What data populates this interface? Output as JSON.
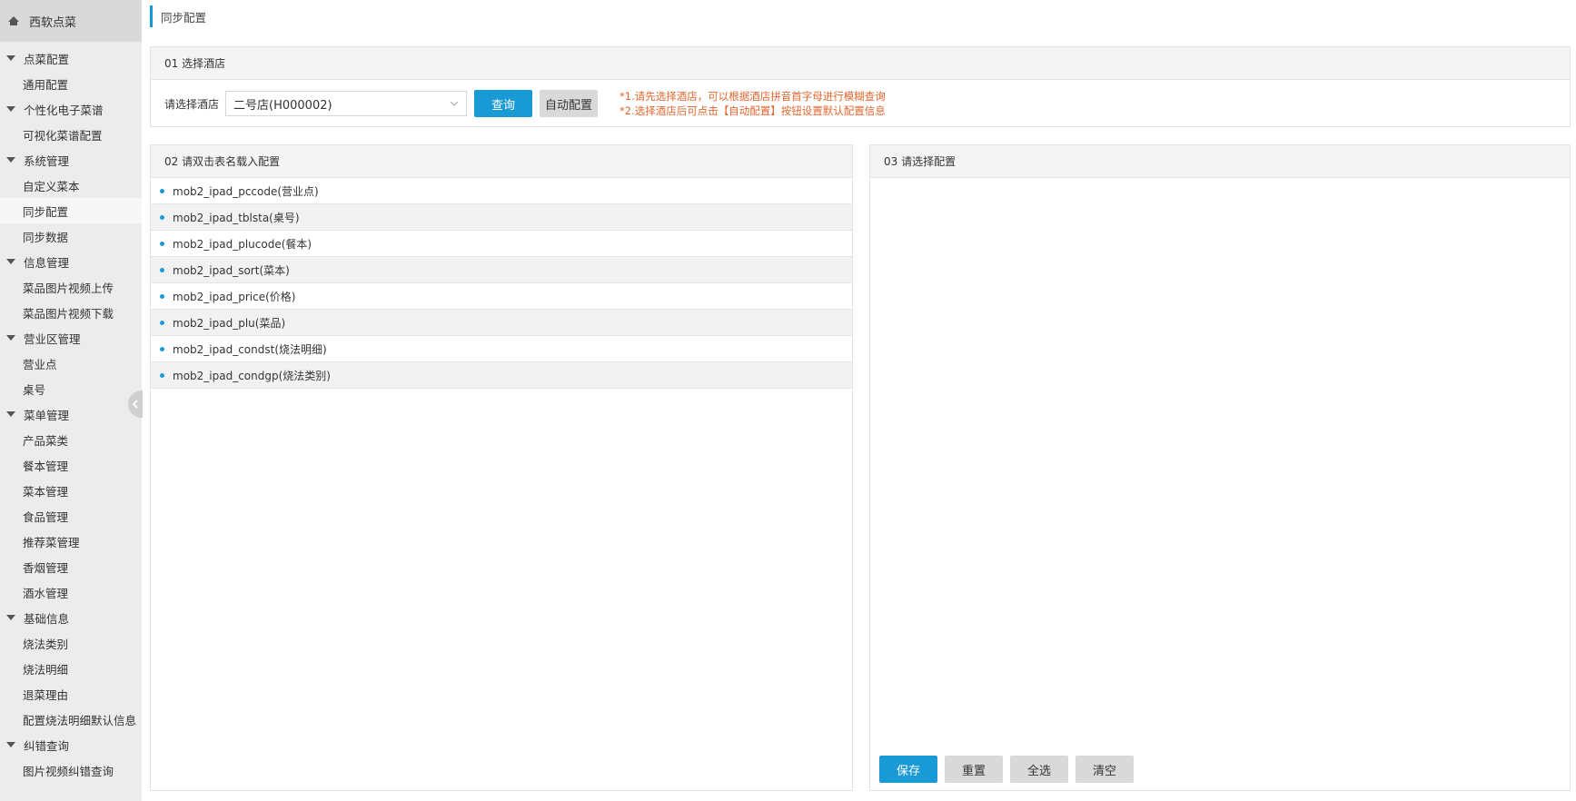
{
  "sidebar": {
    "brand": "西软点菜",
    "groups": [
      {
        "label": "点菜配置",
        "items": [
          "通用配置"
        ]
      },
      {
        "label": "个性化电子菜谱",
        "items": [
          "可视化菜谱配置"
        ]
      },
      {
        "label": "系统管理",
        "items": [
          "自定义菜本",
          "同步配置",
          "同步数据"
        ]
      },
      {
        "label": "信息管理",
        "items": [
          "菜品图片视频上传",
          "菜品图片视频下载"
        ]
      },
      {
        "label": "营业区管理",
        "items": [
          "营业点",
          "桌号"
        ]
      },
      {
        "label": "菜单管理",
        "items": [
          "产品菜类",
          "餐本管理",
          "菜本管理",
          "食品管理",
          "推荐菜管理",
          "香烟管理",
          "酒水管理"
        ]
      },
      {
        "label": "基础信息",
        "items": [
          "烧法类别",
          "烧法明细",
          "退菜理由",
          "配置烧法明细默认信息"
        ]
      },
      {
        "label": "纠错查询",
        "items": [
          "图片视频纠错查询"
        ]
      }
    ]
  },
  "breadcrumb": "同步配置",
  "panel1": {
    "title": "01 选择酒店",
    "select_label": "请选择酒店",
    "select_value": "二号店(H000002)",
    "query_button": "查询",
    "auto_button": "自动配置",
    "note1": "*1.请先选择酒店，可以根据酒店拼音首字母进行模糊查询",
    "note2": "*2.选择酒店后可点击【自动配置】按钮设置默认配置信息"
  },
  "panel2": {
    "title": "02 请双击表名载入配置",
    "tables": [
      "mob2_ipad_pccode(营业点)",
      "mob2_ipad_tblsta(桌号)",
      "mob2_ipad_plucode(餐本)",
      "mob2_ipad_sort(菜本)",
      "mob2_ipad_price(价格)",
      "mob2_ipad_plu(菜品)",
      "mob2_ipad_condst(烧法明细)",
      "mob2_ipad_condgp(烧法类别)"
    ]
  },
  "panel3": {
    "title": "03 请选择配置",
    "save": "保存",
    "reset": "重置",
    "select_all": "全选",
    "clear": "清空"
  },
  "colors": {
    "accent": "#1a9ad5",
    "note": "#e2662f",
    "sidebar_bg": "#ececec"
  }
}
